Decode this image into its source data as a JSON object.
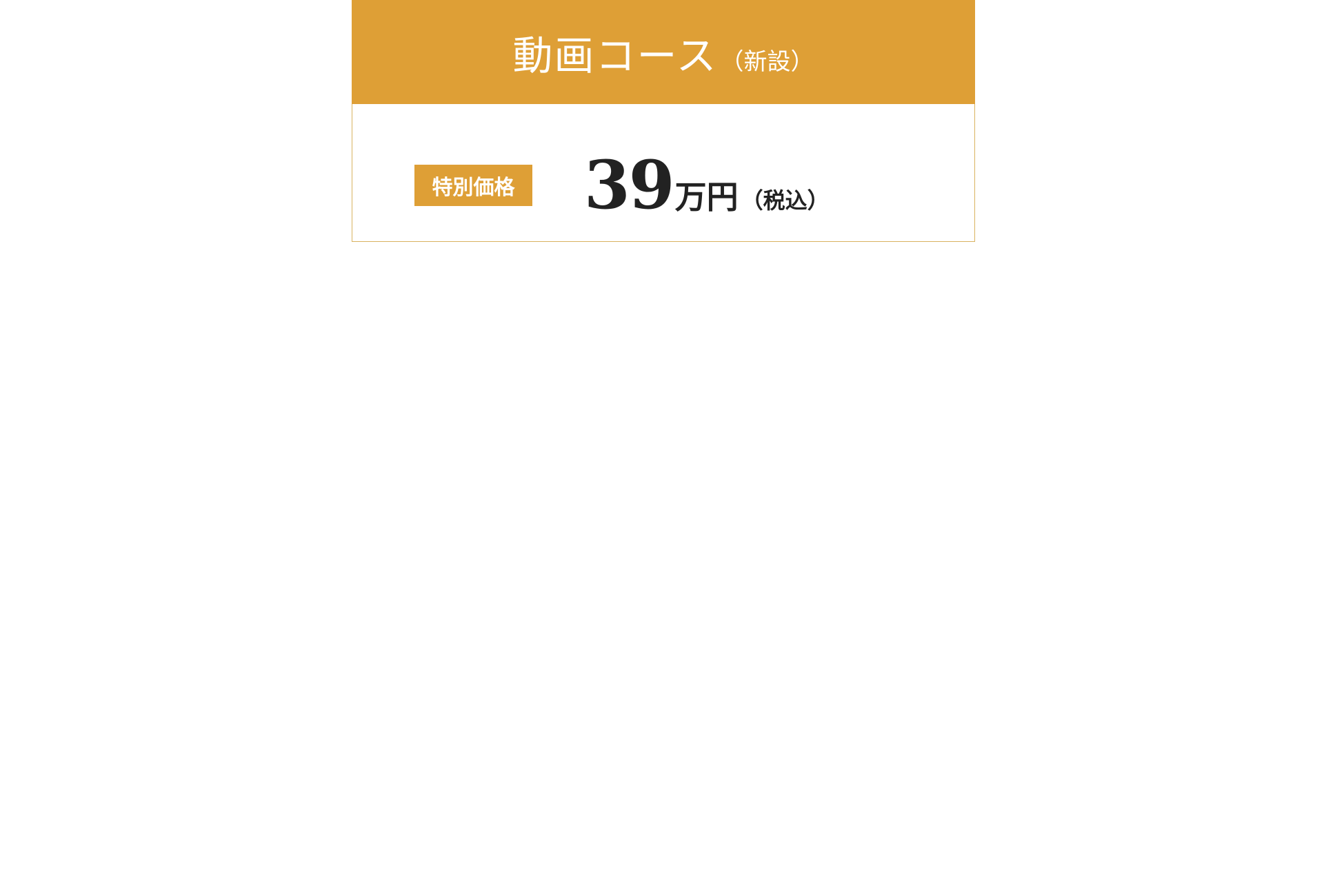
{
  "course": {
    "title": "動画コース",
    "title_note": "（新設）",
    "badge_label": "特別価格",
    "price_amount": "39",
    "price_unit": "万円",
    "price_note": "（税込）"
  },
  "colors": {
    "accent": "#de9f36",
    "border": "#d9b25f",
    "text": "#222222"
  }
}
